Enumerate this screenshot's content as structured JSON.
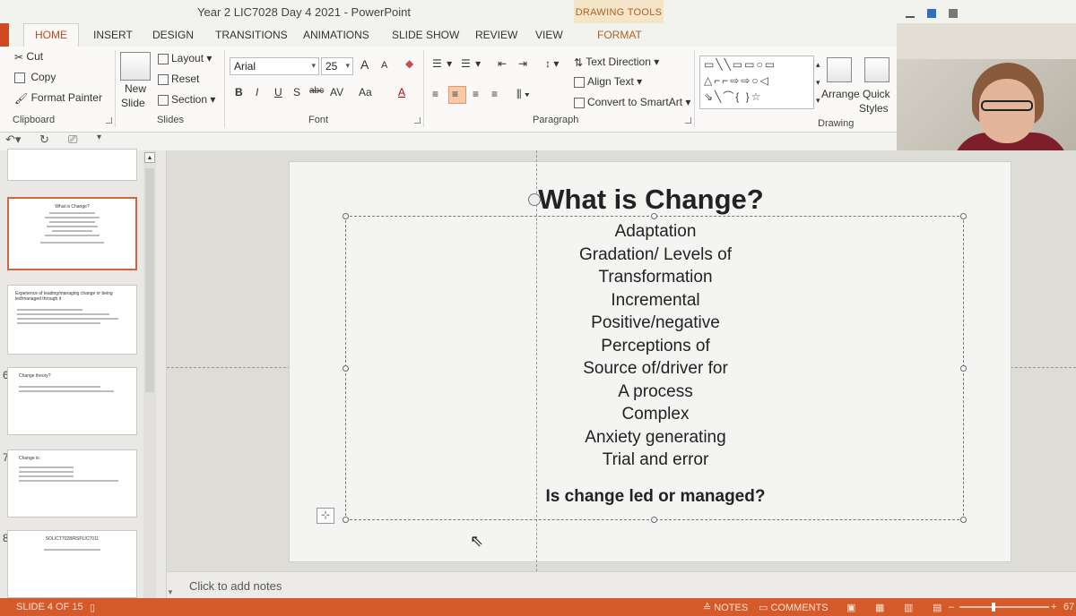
{
  "window": {
    "title": "Year 2 LIC7028 Day 4 2021 - PowerPoint",
    "contextual_header": "DRAWING TOOLS"
  },
  "tabs": [
    {
      "label": "HOME"
    },
    {
      "label": "INSERT"
    },
    {
      "label": "DESIGN"
    },
    {
      "label": "TRANSITIONS"
    },
    {
      "label": "ANIMATIONS"
    },
    {
      "label": "SLIDE SHOW"
    },
    {
      "label": "REVIEW"
    },
    {
      "label": "VIEW"
    },
    {
      "label": "FORMAT"
    }
  ],
  "ribbon": {
    "clipboard": {
      "cut": "Cut",
      "copy": "Copy",
      "format_painter": "Format Painter",
      "label": "Clipboard"
    },
    "slides": {
      "new_slide_line1": "New",
      "new_slide_line2": "Slide",
      "layout": "Layout",
      "reset": "Reset",
      "section": "Section",
      "label": "Slides"
    },
    "font": {
      "name": "Arial",
      "size": "25",
      "label": "Font",
      "bold": "B",
      "italic": "I",
      "underline": "U",
      "shadow": "S",
      "strike": "abc",
      "spacing": "AV",
      "case": "Aa",
      "color": "A",
      "grow": "A",
      "shrink": "A"
    },
    "paragraph": {
      "text_direction": "Text Direction",
      "align_text": "Align Text",
      "convert_smartart": "Convert to SmartArt",
      "label": "Paragraph"
    },
    "drawing": {
      "arrange": "Arrange",
      "quick_styles_line1": "Quick",
      "quick_styles_line2": "Styles",
      "label": "Drawing"
    }
  },
  "thumbnails": {
    "numbers": [
      "6",
      "7",
      "8"
    ],
    "slide4_title": "What is Change?",
    "slide5_title": "Experience of leading/managing change or being led/managed through it",
    "slide6_title": "Change theory?",
    "slide7_title": "Change is:",
    "slide8_title": "SOLICT7028/RSPLIC7011"
  },
  "slide": {
    "title": "What is Change?",
    "bullets": [
      "Adaptation",
      "Gradation/ Levels of",
      "Transformation",
      "Incremental",
      "Positive/negative",
      "Perceptions of",
      "Source of/driver for",
      "A process",
      "Complex",
      "Anxiety generating",
      "Trial and error"
    ],
    "question": "Is change led or managed?"
  },
  "notes": {
    "placeholder": "Click to add notes"
  },
  "status": {
    "slide_indicator": "SLIDE 4 OF 15",
    "notes_btn": "NOTES",
    "comments_btn": "COMMENTS",
    "zoom": "67"
  },
  "icons": [
    "scissors-icon",
    "copy-icon",
    "format-painter-icon",
    "new-slide-icon",
    "undo-icon",
    "redo-icon",
    "notes-icon",
    "comments-icon",
    "normal-view-icon",
    "slide-sorter-icon",
    "reading-view-icon",
    "slideshow-icon"
  ]
}
